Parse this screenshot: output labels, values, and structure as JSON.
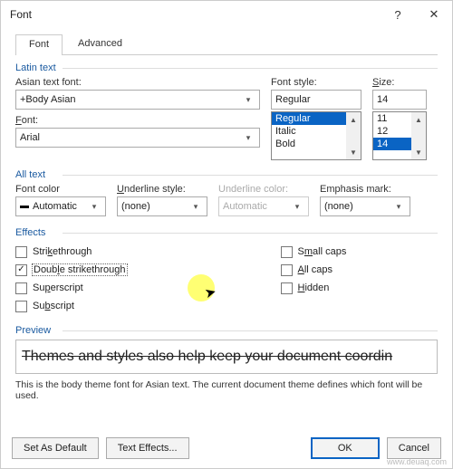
{
  "title": "Font",
  "tabs": {
    "font": "Font",
    "advanced": "Advanced"
  },
  "latin": {
    "section": "Latin text",
    "asian_font_label": "Asian text font:",
    "asian_font_value": "+Body Asian",
    "font_label": "Font:",
    "font_value": "Arial",
    "style_label": "Font style:",
    "style_value": "Regular",
    "style_options": [
      "Regular",
      "Italic",
      "Bold"
    ],
    "size_label": "Size:",
    "size_value": "14",
    "size_options": [
      "11",
      "12",
      "14"
    ]
  },
  "alltext": {
    "section": "All text",
    "font_color_label": "Font color",
    "font_color_value": "Automatic",
    "underline_style_label": "Underline style:",
    "underline_style_value": "(none)",
    "underline_color_label": "Underline color:",
    "underline_color_value": "Automatic",
    "emphasis_label": "Emphasis mark:",
    "emphasis_value": "(none)"
  },
  "effects": {
    "section": "Effects",
    "strikethrough": "Strikethrough",
    "double_strikethrough": "Double strikethrough",
    "superscript": "Superscript",
    "subscript": "Subscript",
    "small_caps": "Small caps",
    "all_caps": "All caps",
    "hidden": "Hidden",
    "checked": {
      "double_strikethrough": true
    }
  },
  "preview": {
    "section": "Preview",
    "text": "Themes and styles also help keep your document coordin",
    "note": "This is the body theme font for Asian text. The current document theme defines which font will be used."
  },
  "footer": {
    "set_default": "Set As Default",
    "text_effects": "Text Effects...",
    "ok": "OK",
    "cancel": "Cancel"
  },
  "watermark": "www.deuaq.com"
}
